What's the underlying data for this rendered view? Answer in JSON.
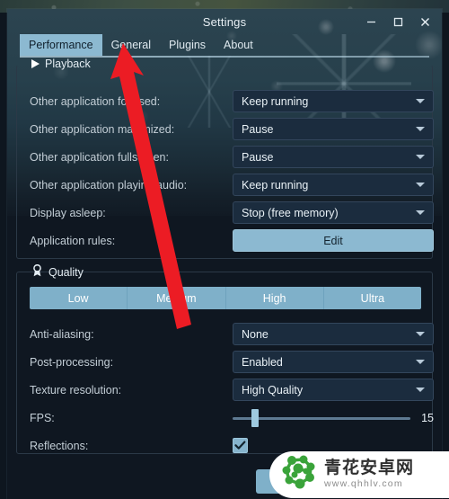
{
  "window": {
    "title": "Settings",
    "controls": [
      {
        "name": "minimize",
        "glyph": "minimize-icon"
      },
      {
        "name": "maximize",
        "glyph": "maximize-icon"
      },
      {
        "name": "close",
        "glyph": "close-icon"
      }
    ]
  },
  "tabs": [
    {
      "label": "Performance",
      "active": true
    },
    {
      "label": "General",
      "active": false
    },
    {
      "label": "Plugins",
      "active": false
    },
    {
      "label": "About",
      "active": false
    }
  ],
  "playback": {
    "title": "Playback",
    "icon": "play-icon",
    "rows": [
      {
        "label": "Other application focused:",
        "value": "Keep running",
        "control": "dropdown"
      },
      {
        "label": "Other application maximized:",
        "value": "Pause",
        "control": "dropdown"
      },
      {
        "label": "Other application fullscreen:",
        "value": "Pause",
        "control": "dropdown"
      },
      {
        "label": "Other application playing audio:",
        "value": "Keep running",
        "control": "dropdown"
      },
      {
        "label": "Display asleep:",
        "value": "Stop (free memory)",
        "control": "dropdown"
      },
      {
        "label": "Application rules:",
        "value": "Edit",
        "control": "button"
      }
    ]
  },
  "quality": {
    "title": "Quality",
    "icon": "medal-icon",
    "presets": [
      "Low",
      "Medium",
      "High",
      "Ultra"
    ],
    "rows": [
      {
        "label": "Anti-aliasing:",
        "value": "None",
        "control": "dropdown"
      },
      {
        "label": "Post-processing:",
        "value": "Enabled",
        "control": "dropdown"
      },
      {
        "label": "Texture resolution:",
        "value": "High Quality",
        "control": "dropdown"
      },
      {
        "label": "FPS:",
        "value": "15",
        "control": "slider"
      },
      {
        "label": "Reflections:",
        "value": "checked",
        "control": "checkbox"
      }
    ]
  },
  "watermark": {
    "name_cn": "青花安卓网",
    "url": "www.qhhlv.com"
  },
  "colors": {
    "accent": "#8cb9d1",
    "panel_bg": "#0f1721",
    "dropdown_bg": "#1b2c3e",
    "arrow": "#ec1c24",
    "watermark_green": "#3aa33a"
  }
}
